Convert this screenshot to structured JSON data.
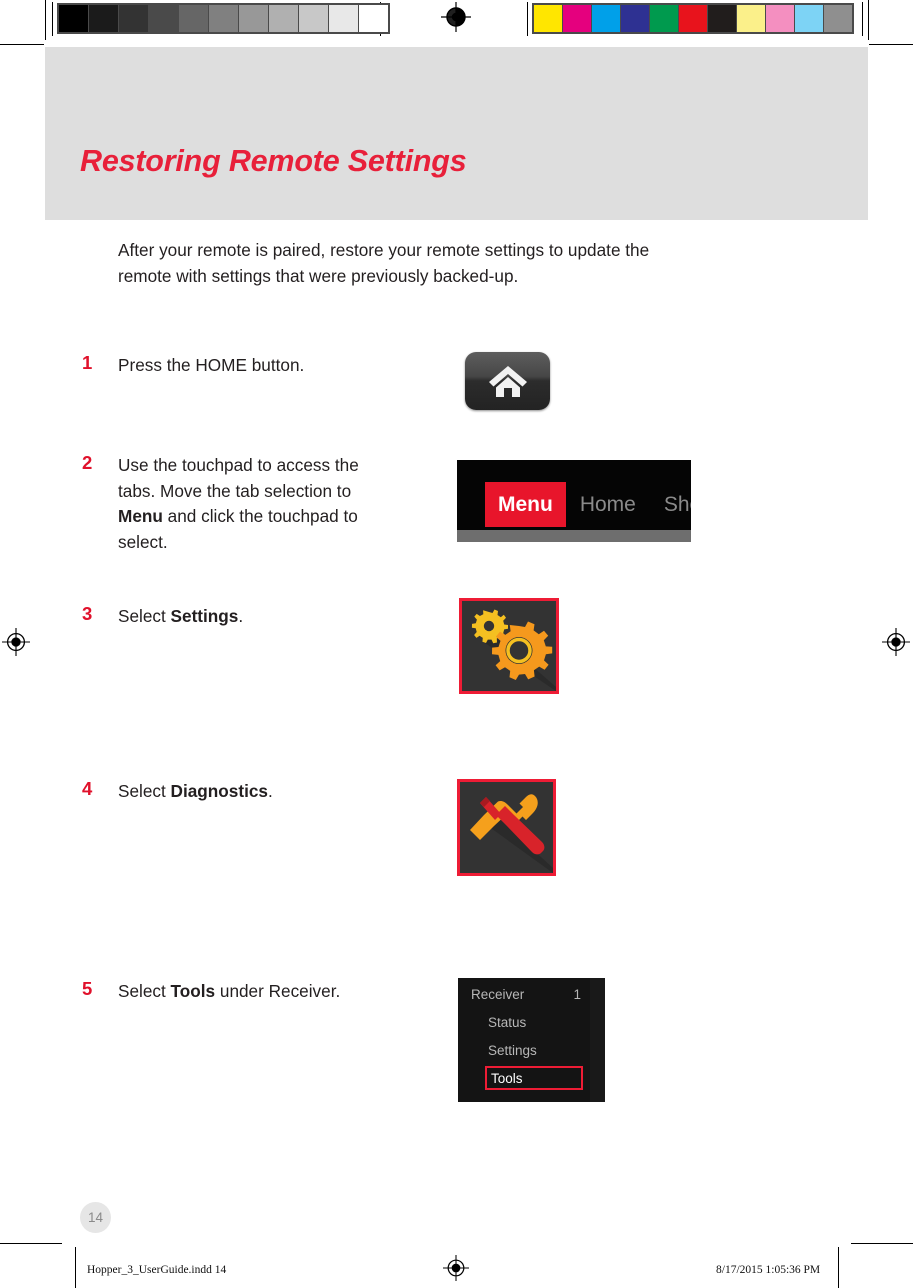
{
  "document": {
    "page_title": "Restoring Remote Settings",
    "page_number": "14"
  },
  "intro": {
    "paragraph": "After your remote is paired, restore your remote settings to update the remote with settings that were previously backed-up."
  },
  "steps": [
    {
      "number": "1",
      "text_parts": [
        {
          "text": "Press the HOME button.",
          "bold": false
        }
      ],
      "graphic": "home-button"
    },
    {
      "number": "2",
      "text_parts": [
        {
          "text": "Use the touchpad to access the tabs. Move the tab selection to ",
          "bold": false
        },
        {
          "text": "Menu",
          "bold": true
        },
        {
          "text": " and click the touchpad to select.",
          "bold": false
        }
      ],
      "graphic": "tab-bar"
    },
    {
      "number": "3",
      "text_parts": [
        {
          "text": "Select ",
          "bold": false
        },
        {
          "text": "Settings",
          "bold": true
        },
        {
          "text": ".",
          "bold": false
        }
      ],
      "graphic": "settings-tile"
    },
    {
      "number": "4",
      "text_parts": [
        {
          "text": "Select ",
          "bold": false
        },
        {
          "text": "Diagnostics",
          "bold": true
        },
        {
          "text": ".",
          "bold": false
        }
      ],
      "graphic": "diagnostics-tile"
    },
    {
      "number": "5",
      "text_parts": [
        {
          "text": "Select ",
          "bold": false
        },
        {
          "text": "Tools",
          "bold": true
        },
        {
          "text": " under Receiver.",
          "bold": false
        }
      ],
      "graphic": "receiver-menu"
    }
  ],
  "graphics": {
    "home_button": {
      "icon": "home-icon"
    },
    "tab_bar": {
      "tabs": [
        {
          "label": "Menu",
          "selected": true
        },
        {
          "label": "Home",
          "selected": false
        },
        {
          "label": "Sho",
          "selected": false
        }
      ]
    },
    "settings_tile": {
      "icon": "gears-icon"
    },
    "diagnostics_tile": {
      "icon": "screwdriver-wrench-icon"
    },
    "receiver_menu": {
      "header_label": "Receiver",
      "header_value": "1",
      "items": [
        {
          "label": "Status",
          "selected": false
        },
        {
          "label": "Settings",
          "selected": false
        },
        {
          "label": "Tools",
          "selected": true
        }
      ]
    }
  },
  "footer": {
    "filename": "Hopper_3_UserGuide.indd   14",
    "timestamp": "8/17/2015   1:05:36 PM"
  },
  "calibration": {
    "gray_swatches": [
      "#000000",
      "#1b1b1b",
      "#333333",
      "#4a4a4a",
      "#666666",
      "#808080",
      "#989898",
      "#b0b0b0",
      "#c8c8c8",
      "#e8e8e8",
      "#ffffff"
    ],
    "color_swatches": [
      "#ffe600",
      "#e5007e",
      "#00a0e9",
      "#2e3192",
      "#009a4e",
      "#e8131c",
      "#211d1c",
      "#fbf08a",
      "#f48fc0",
      "#7dd3f5",
      "#8f8f8f"
    ]
  },
  "theme": {
    "brand_red": "#e8203a",
    "banner_gray": "#dedede",
    "text_black": "#231f20",
    "tile_dark": "#333333",
    "accent_orange": "#f9a01b"
  }
}
